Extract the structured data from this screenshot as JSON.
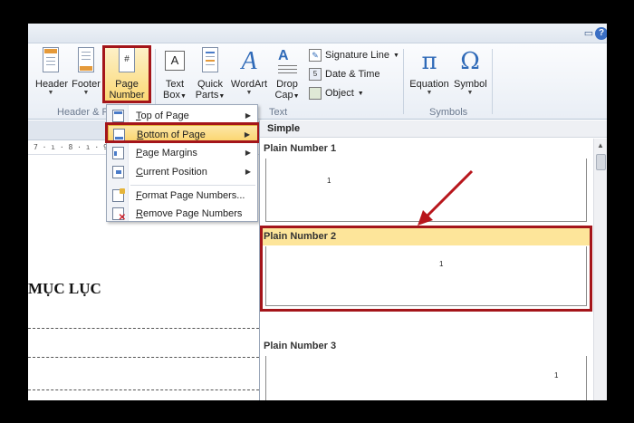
{
  "titlebar": {
    "restore_icon": "restore-icon",
    "help_label": "?"
  },
  "ribbon": {
    "header_button": "Header",
    "footer_button": "Footer",
    "page_number_button_line1": "Page",
    "page_number_button_line2": "Number",
    "text_box_line1": "Text",
    "text_box_line2": "Box",
    "quick_parts_line1": "Quick",
    "quick_parts_line2": "Parts",
    "wordart": "WordArt",
    "drop_cap_line1": "Drop",
    "drop_cap_line2": "Cap",
    "signature_line": "Signature Line",
    "date_time": "Date & Time",
    "object": "Object",
    "equation": "Equation",
    "symbol": "Symbol",
    "group_header_footer": "Header & F",
    "group_text": "Text",
    "group_symbols": "Symbols",
    "pi_glyph": "π",
    "omega_glyph": "Ω"
  },
  "ruler_text": "7 · ı · 8 · ı · 9",
  "document": {
    "heading": "MỤC LỤC"
  },
  "menu": {
    "items": [
      {
        "label": "Top of Page",
        "ul": "T",
        "rest": "op of Page"
      },
      {
        "label": "Bottom of Page",
        "ul": "B",
        "rest": "ottom of Page"
      },
      {
        "label": "Page Margins",
        "ul": "P",
        "rest": "age Margins"
      },
      {
        "label": "Current Position",
        "ul": "C",
        "rest": "urrent Position"
      },
      {
        "label": "Format Page Numbers...",
        "ul": "F",
        "rest": "ormat Page Numbers..."
      },
      {
        "label": "Remove Page Numbers",
        "ul": "R",
        "rest": "emove Page Numbers"
      }
    ]
  },
  "gallery": {
    "section": "Simple",
    "items": [
      {
        "label": "Plain Number 1",
        "number": "1"
      },
      {
        "label": "Plain Number 2",
        "number": "1"
      },
      {
        "label": "Plain Number 3",
        "number": "1"
      }
    ]
  },
  "colors": {
    "highlight_red": "#a4151a",
    "selected_fill": "#fde59a"
  }
}
